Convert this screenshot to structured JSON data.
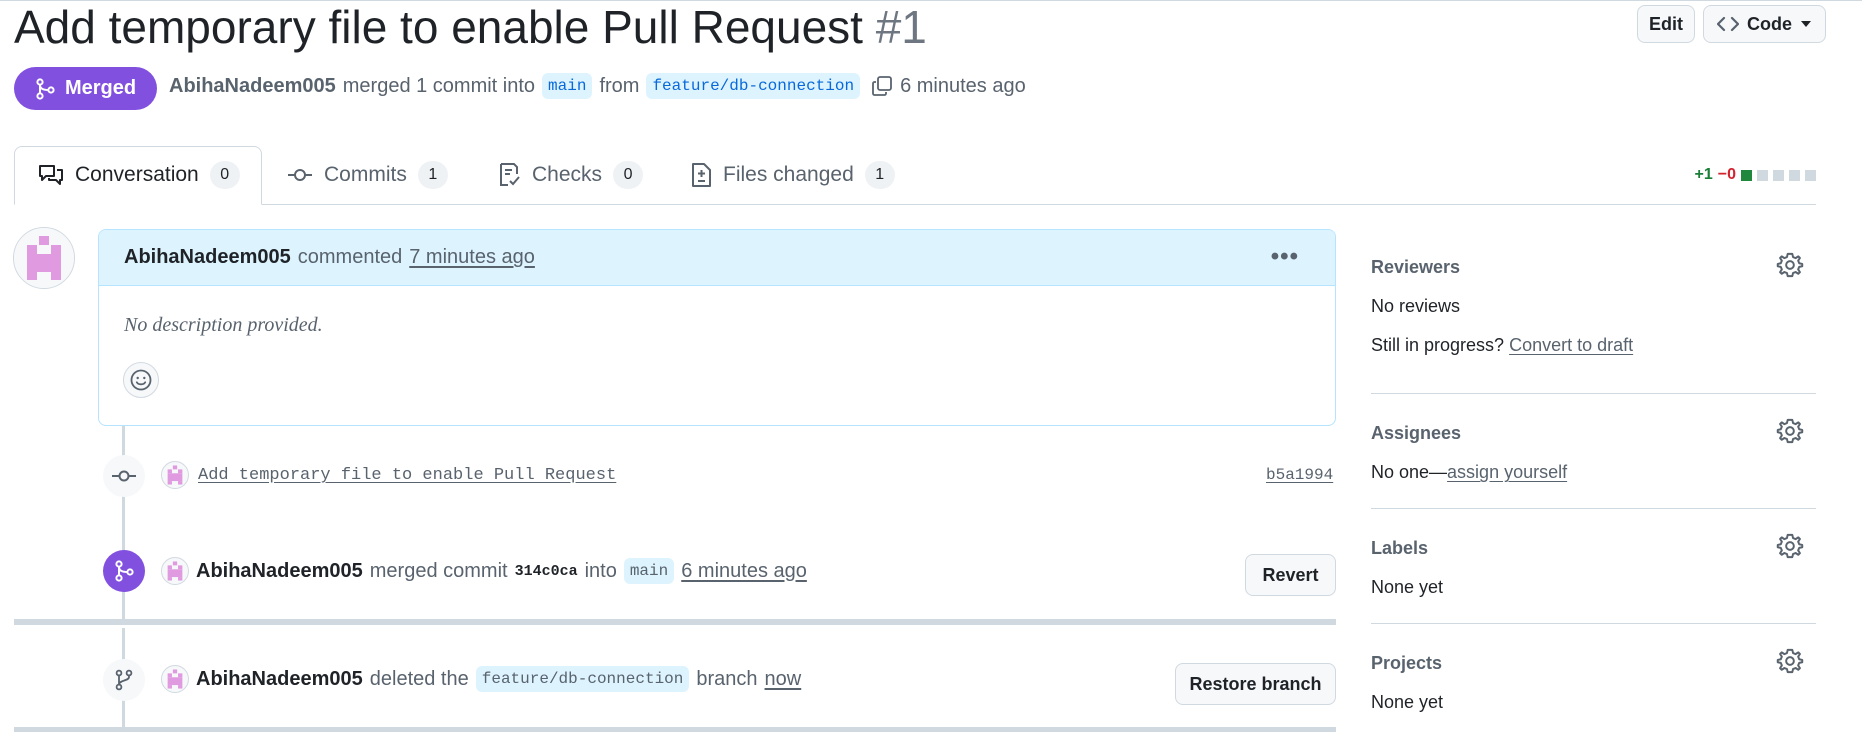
{
  "header": {
    "title": "Add temporary file to enable Pull Request",
    "number": "#1",
    "edit_label": "Edit",
    "code_label": "Code",
    "state_label": "Merged",
    "author": "AbihaNadeem005",
    "action_text": "merged 1 commit into",
    "base_branch": "main",
    "from_text": "from",
    "head_branch": "feature/db-connection",
    "time_ago": "6 minutes ago"
  },
  "tabs": [
    {
      "label": "Conversation",
      "count": "0",
      "icon": "comment-discussion-icon"
    },
    {
      "label": "Commits",
      "count": "1",
      "icon": "commit-icon"
    },
    {
      "label": "Checks",
      "count": "0",
      "icon": "checklist-icon"
    },
    {
      "label": "Files changed",
      "count": "1",
      "icon": "file-diff-icon"
    }
  ],
  "diffstat": {
    "additions": "+1",
    "deletions": "−0"
  },
  "comment": {
    "author": "AbihaNadeem005",
    "action": "commented",
    "time": "7 minutes ago",
    "body": "No description provided."
  },
  "timeline": {
    "commit": {
      "message": "Add temporary file to enable Pull Request",
      "sha": "b5a1994"
    },
    "merged": {
      "author": "AbihaNadeem005",
      "action": "merged commit",
      "sha": "314c0ca",
      "into": "into",
      "branch": "main",
      "time": "6 minutes ago",
      "button": "Revert"
    },
    "deleted": {
      "author": "AbihaNadeem005",
      "action": "deleted the",
      "branch": "feature/db-connection",
      "suffix": "branch",
      "time": "now",
      "button": "Restore branch"
    }
  },
  "sidebar": {
    "reviewers": {
      "title": "Reviewers",
      "value": "No reviews",
      "progress_text": "Still in progress?",
      "progress_link": "Convert to draft"
    },
    "assignees": {
      "title": "Assignees",
      "value": "No one—",
      "link": "assign yourself"
    },
    "labels": {
      "title": "Labels",
      "value": "None yet"
    },
    "projects": {
      "title": "Projects",
      "value": "None yet"
    }
  },
  "colors": {
    "merged": "#8250df",
    "link": "#0969da",
    "branch_bg": "#ddf4ff",
    "addition": "#1a7f37",
    "deletion": "#d1242f"
  }
}
